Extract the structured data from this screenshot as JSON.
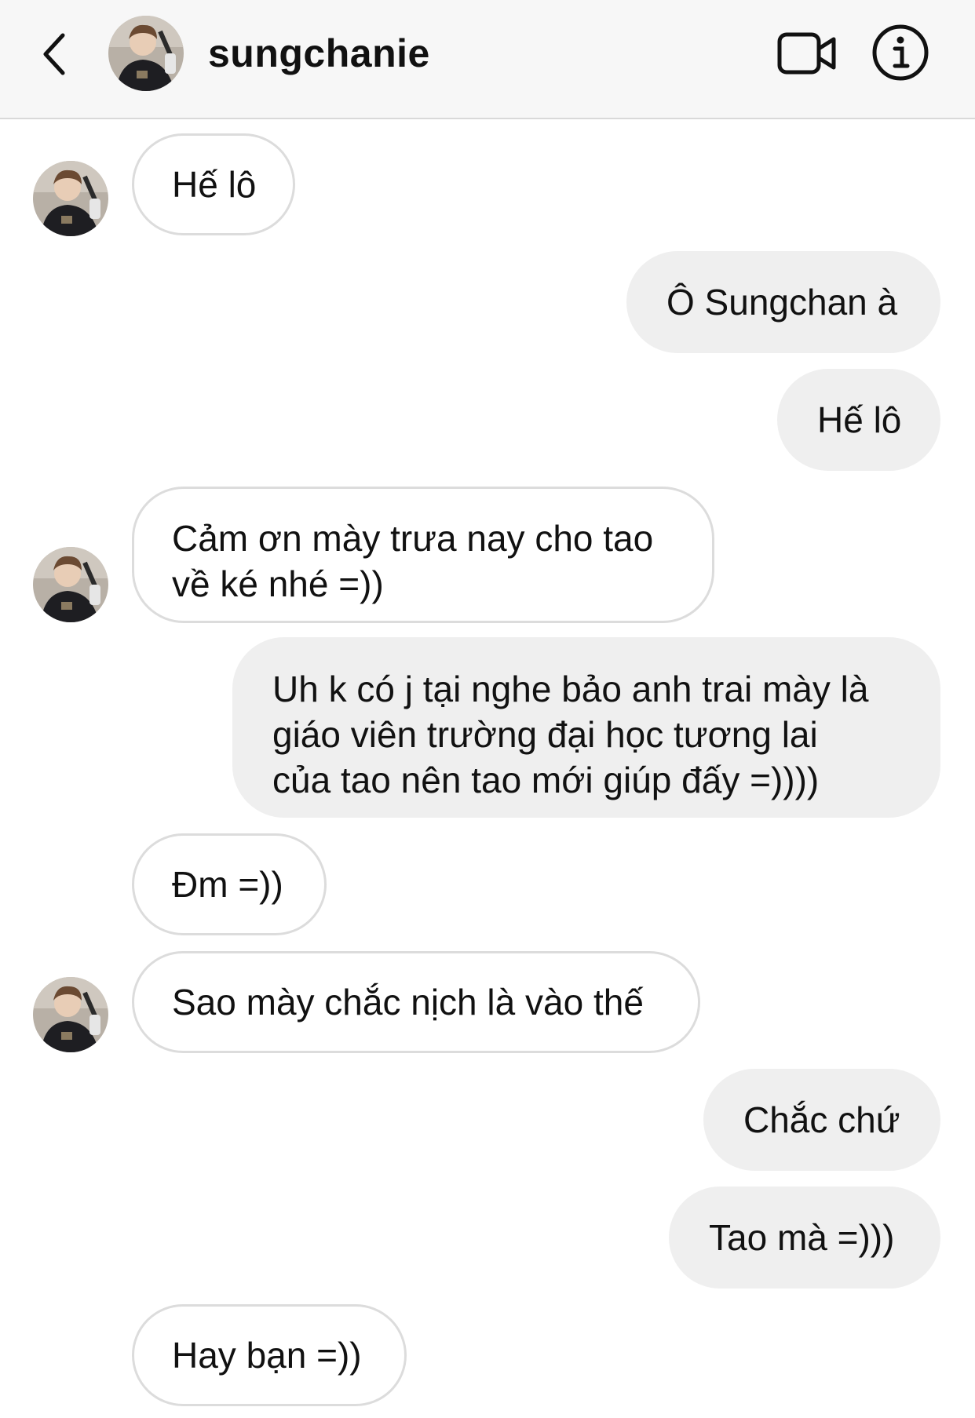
{
  "header": {
    "username": "sungchanie",
    "back_icon": "chevron-left-icon",
    "video_icon": "video-camera-icon",
    "info_icon": "info-icon"
  },
  "messages": [
    {
      "from": "them",
      "text": "Hế lô"
    },
    {
      "from": "me",
      "text": "Ô Sungchan à"
    },
    {
      "from": "me",
      "text": "Hế lô"
    },
    {
      "from": "them",
      "line1": "Cảm ơn mày trưa nay cho tao",
      "line2": "về ké nhé =))"
    },
    {
      "from": "me",
      "line1": "Uh k có j tại nghe bảo anh trai mày là",
      "line2": "giáo viên trường đại học tương lai",
      "line3": "của tao nên tao mới giúp đấy =))))"
    },
    {
      "from": "them",
      "text": "Đm =))"
    },
    {
      "from": "them",
      "text": "Sao mày chắc nịch là vào thế"
    },
    {
      "from": "me",
      "text": "Chắc chứ"
    },
    {
      "from": "me",
      "text": "Tao mà =)))"
    },
    {
      "from": "them",
      "text": "Hay bạn =))"
    }
  ]
}
